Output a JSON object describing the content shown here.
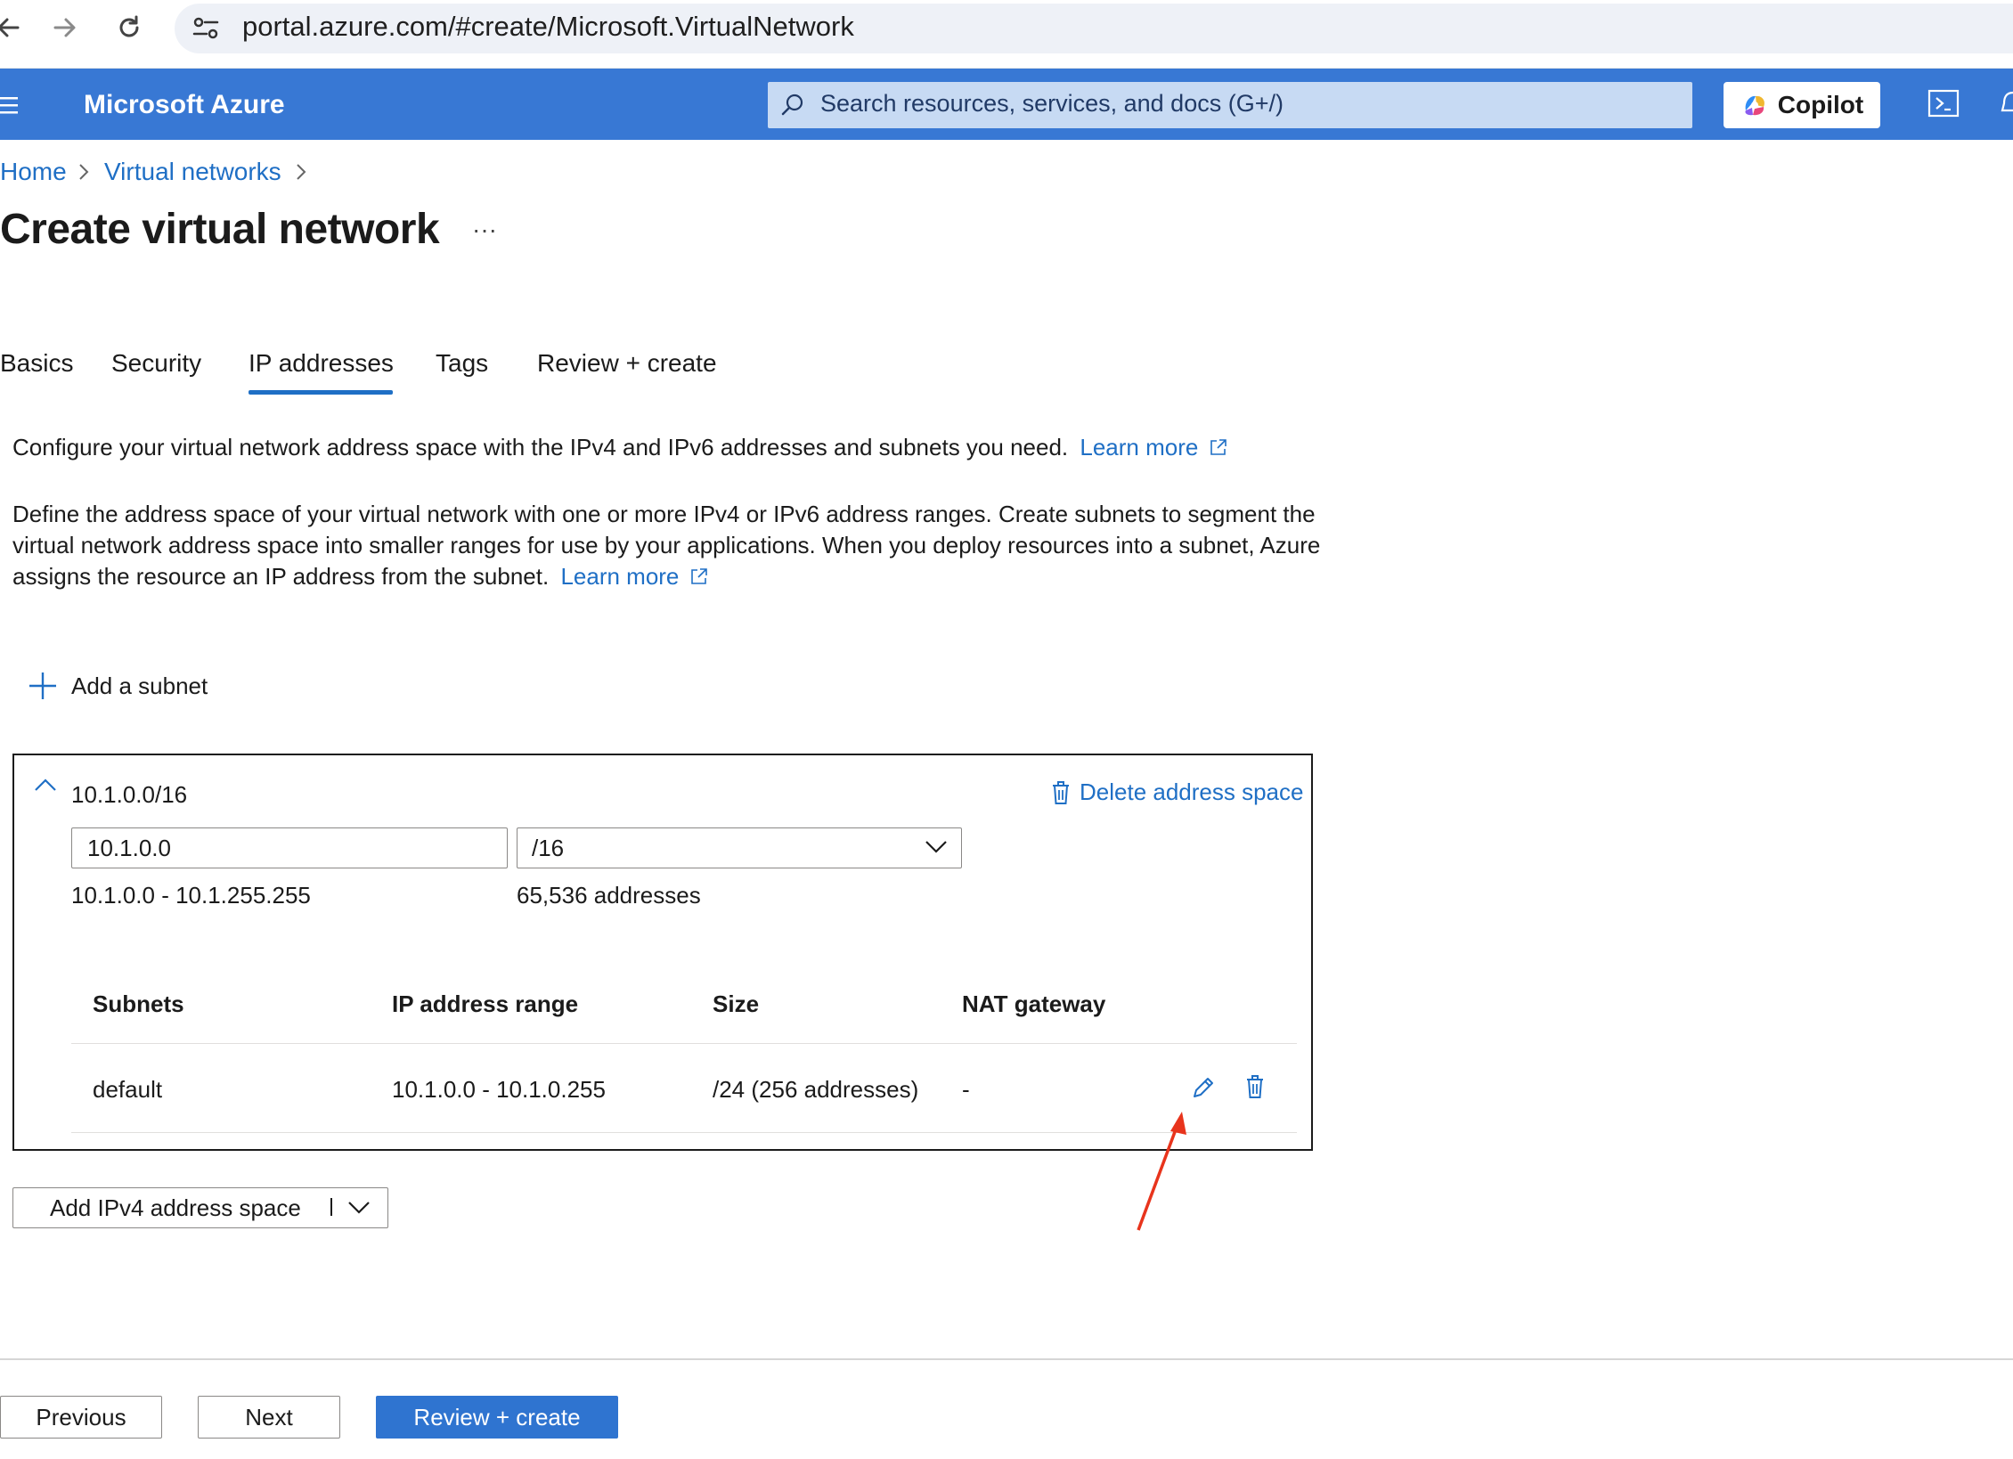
{
  "browser": {
    "url": "portal.azure.com/#create/Microsoft.VirtualNetwork",
    "back_icon": "arrow-left-icon",
    "forward_icon": "arrow-right-icon",
    "reload_icon": "reload-icon",
    "site_settings_icon": "tune-icon"
  },
  "header": {
    "brand": "Microsoft Azure",
    "search_placeholder": "Search resources, services, and docs (G+/)",
    "copilot_label": "Copilot",
    "accent_color": "#3878d4"
  },
  "breadcrumb": {
    "items": [
      "Home",
      "Virtual networks"
    ]
  },
  "page": {
    "title": "Create virtual network",
    "more": "···"
  },
  "tabs": [
    {
      "label": "Basics"
    },
    {
      "label": "Security"
    },
    {
      "label": "IP addresses",
      "active": true
    },
    {
      "label": "Tags"
    },
    {
      "label": "Review + create"
    }
  ],
  "intro": {
    "text1": "Configure your virtual network address space with the IPv4 and IPv6 addresses and subnets you need.",
    "learn_more": "Learn more",
    "text2_line1": "Define the address space of your virtual network with one or more IPv4 or IPv6 address ranges. Create subnets to segment the",
    "text2_line2": "virtual network address space into smaller ranges for use by your applications. When you deploy resources into a subnet, Azure",
    "text2_line3": "assigns the resource an IP address from the subnet.",
    "learn_more2": "Learn more"
  },
  "add_subnet_label": "Add a subnet",
  "address_space": {
    "header": "10.1.0.0/16",
    "delete_label": "Delete address space",
    "address_value": "10.1.0.0",
    "prefix_value": "/16",
    "range_text": "10.1.0.0 - 10.1.255.255",
    "count_text": "65,536 addresses",
    "table": {
      "headers": [
        "Subnets",
        "IP address range",
        "Size",
        "NAT gateway"
      ],
      "rows": [
        {
          "name": "default",
          "range": "10.1.0.0 - 10.1.0.255",
          "size": "/24 (256 addresses)",
          "nat": "-"
        }
      ]
    }
  },
  "add_ipv4_label": "Add IPv4 address space",
  "annotation_color": "#e8341c",
  "footer": {
    "previous": "Previous",
    "next": "Next",
    "review_create": "Review + create"
  }
}
